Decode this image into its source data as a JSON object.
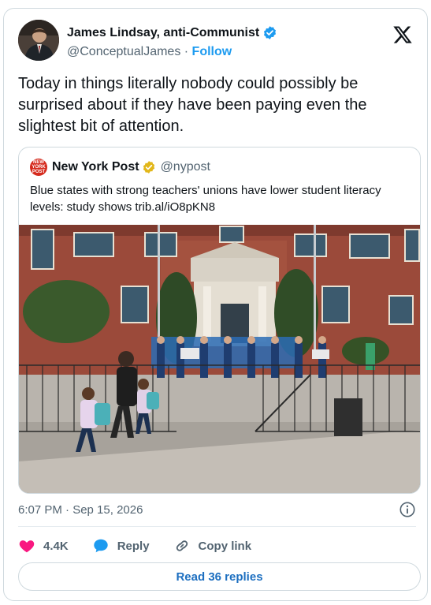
{
  "author": {
    "name": "James Lindsay, anti-Communist",
    "handle": "@ConceptualJames",
    "separator": "·",
    "follow_label": "Follow"
  },
  "tweet": {
    "text": "Today in things literally nobody could possibly be surprised about if they have been paying even the slightest bit of attention."
  },
  "quote": {
    "logo_text": "NEW YORK POST",
    "name": "New York Post",
    "handle": "@nypost",
    "text": "Blue states with strong teachers' unions have lower student literacy levels: study shows trib.al/iO8pKN8"
  },
  "meta": {
    "timestamp": "6:07 PM · Sep 15, 2026"
  },
  "actions": {
    "like_count": "4.4K",
    "reply_label": "Reply",
    "copy_link_label": "Copy link"
  },
  "read_replies_label": "Read 36 replies",
  "colors": {
    "blue": "#1d9bf0",
    "like_pink": "#f91880",
    "gold": "#e2b719",
    "nyp_red": "#d52b1e"
  }
}
